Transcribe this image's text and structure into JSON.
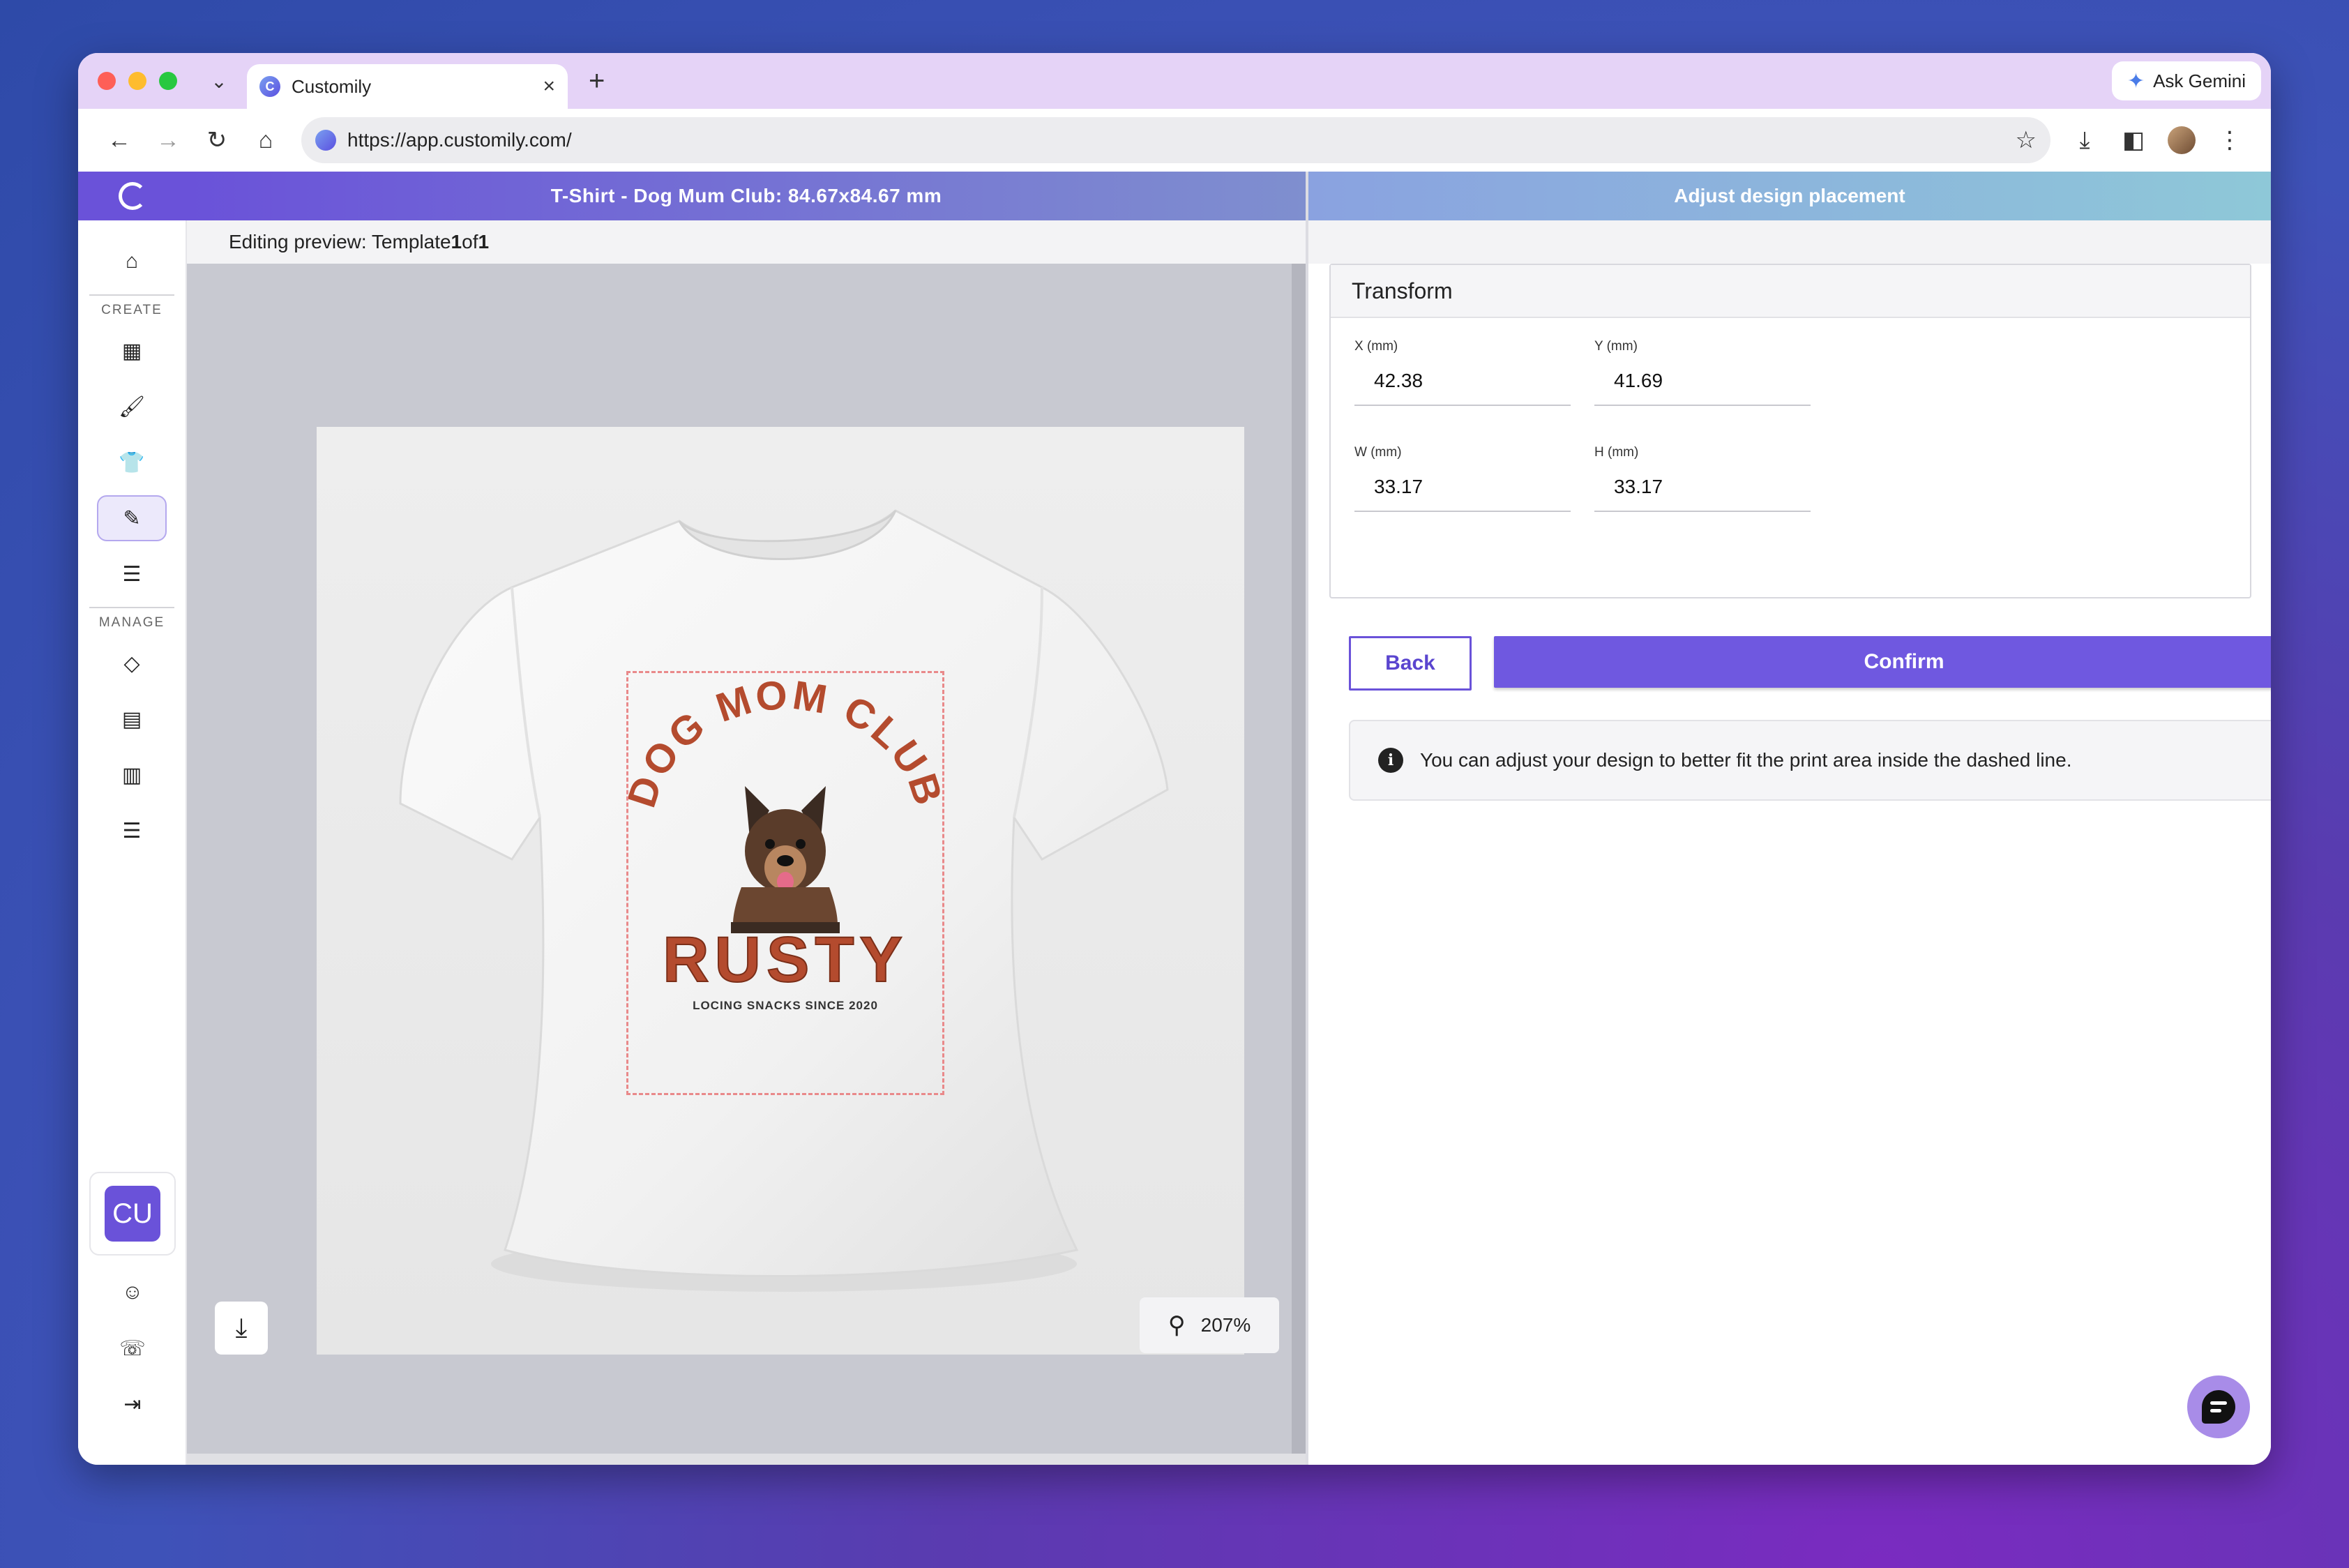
{
  "browser": {
    "tab_title": "Customily",
    "tab_close": "×",
    "new_tab": "+",
    "tab_menu": "⌄",
    "ask_gemini": "Ask Gemini",
    "url": "https://app.customily.com/",
    "back": "←",
    "forward": "→",
    "reload": "↻",
    "home": "⌂",
    "bookmark_star": "☆",
    "download": "⤓",
    "sidebar_toggle": "◧",
    "menu": "⋮"
  },
  "sidebar": {
    "create_label": "CREATE",
    "manage_label": "MANAGE",
    "home_icon": "⌂",
    "create_items": [
      {
        "name": "templates-icon",
        "glyph": "▦"
      },
      {
        "name": "brush-icon",
        "glyph": "🖌"
      },
      {
        "name": "tshirt-icon",
        "glyph": "👕"
      },
      {
        "name": "design-tools-icon",
        "glyph": "✎"
      },
      {
        "name": "list-icon",
        "glyph": "☰"
      }
    ],
    "manage_items": [
      {
        "name": "tag-icon",
        "glyph": "◇"
      },
      {
        "name": "document-icon",
        "glyph": "▤"
      },
      {
        "name": "store-icon",
        "glyph": "▥"
      },
      {
        "name": "list-tree-icon",
        "glyph": "☰"
      }
    ],
    "account_badge": "CU",
    "profile_icon": "☺",
    "support_icon": "☏",
    "logout_icon": "⇥"
  },
  "editor": {
    "title": "T-Shirt - Dog Mum Club: 84.67x84.67 mm",
    "preview_prefix": "Editing preview: Template ",
    "preview_current": "1",
    "preview_of": " of ",
    "preview_total": "1",
    "zoom_level": "207%",
    "zoom_icon": "⚲",
    "download_icon": "⤓",
    "design": {
      "line1": "DOG MOM CLUB",
      "line2": "RUSTY",
      "line3": "LOCING SNACKS SINCE 2020"
    }
  },
  "panel": {
    "title": "Adjust design placement",
    "card_title": "Transform",
    "fields": [
      {
        "label": "X (mm)",
        "value": "42.38"
      },
      {
        "label": "Y (mm)",
        "value": "41.69"
      },
      {
        "label": "W (mm)",
        "value": "33.17"
      },
      {
        "label": "H (mm)",
        "value": "33.17"
      }
    ],
    "back_label": "Back",
    "confirm_label": "Confirm",
    "info_icon": "i",
    "info_text": "You can adjust your design to better fit the print area inside the dashed line."
  }
}
